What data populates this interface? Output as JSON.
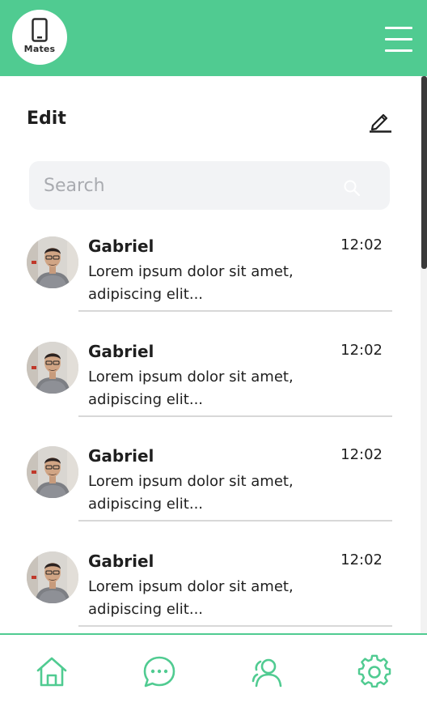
{
  "header": {
    "logo_text": "Mates"
  },
  "toolbar": {
    "edit_label": "Edit"
  },
  "search": {
    "placeholder": "Search"
  },
  "messages": [
    {
      "name": "Gabriel",
      "time": "12:02",
      "preview": "Lorem ipsum dolor sit amet, adipiscing elit..."
    },
    {
      "name": "Gabriel",
      "time": "12:02",
      "preview": "Lorem ipsum dolor sit amet, adipiscing elit..."
    },
    {
      "name": "Gabriel",
      "time": "12:02",
      "preview": "Lorem ipsum dolor sit amet, adipiscing elit..."
    },
    {
      "name": "Gabriel",
      "time": "12:02",
      "preview": "Lorem ipsum dolor sit amet, adipiscing elit..."
    }
  ],
  "bottom_nav": {
    "items": [
      {
        "icon": "home-icon"
      },
      {
        "icon": "chat-icon"
      },
      {
        "icon": "contacts-icon"
      },
      {
        "icon": "settings-icon"
      }
    ]
  },
  "colors": {
    "accent": "#50cb91",
    "search_bg": "#f2f3f5",
    "divider": "#d8d8d8"
  }
}
